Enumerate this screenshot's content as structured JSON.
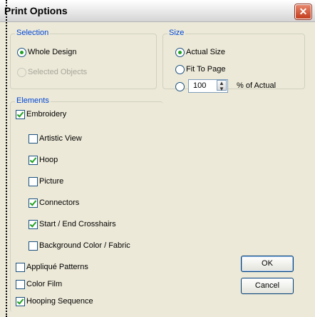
{
  "window": {
    "title": "Print Options",
    "close_glyph": "✕"
  },
  "selection": {
    "legend": "Selection",
    "whole_design": "Whole Design",
    "selected_objects": "Selected Objects"
  },
  "size": {
    "legend": "Size",
    "actual_size": "Actual Size",
    "fit_to_page": "Fit To Page",
    "percent_value": "100",
    "percent_label": "% of Actual",
    "selected": "Actual Size"
  },
  "elements": {
    "legend": "Elements",
    "items": [
      {
        "label": "Embroidery",
        "checked": true
      },
      {
        "label": "Artistic View",
        "checked": false
      },
      {
        "label": "Hoop",
        "checked": true
      },
      {
        "label": "Picture",
        "checked": false
      },
      {
        "label": "Connectors",
        "checked": true
      },
      {
        "label": "Start / End Crosshairs",
        "checked": true
      },
      {
        "label": "Background Color / Fabric",
        "checked": false
      },
      {
        "label": "Appliqué Patterns",
        "checked": false
      },
      {
        "label": "Color Film",
        "checked": false
      },
      {
        "label": "Hooping Sequence",
        "checked": true
      }
    ]
  },
  "buttons": {
    "ok": "OK",
    "cancel": "Cancel"
  },
  "colors": {
    "group_label": "#0046d5",
    "check": "#21a121"
  }
}
